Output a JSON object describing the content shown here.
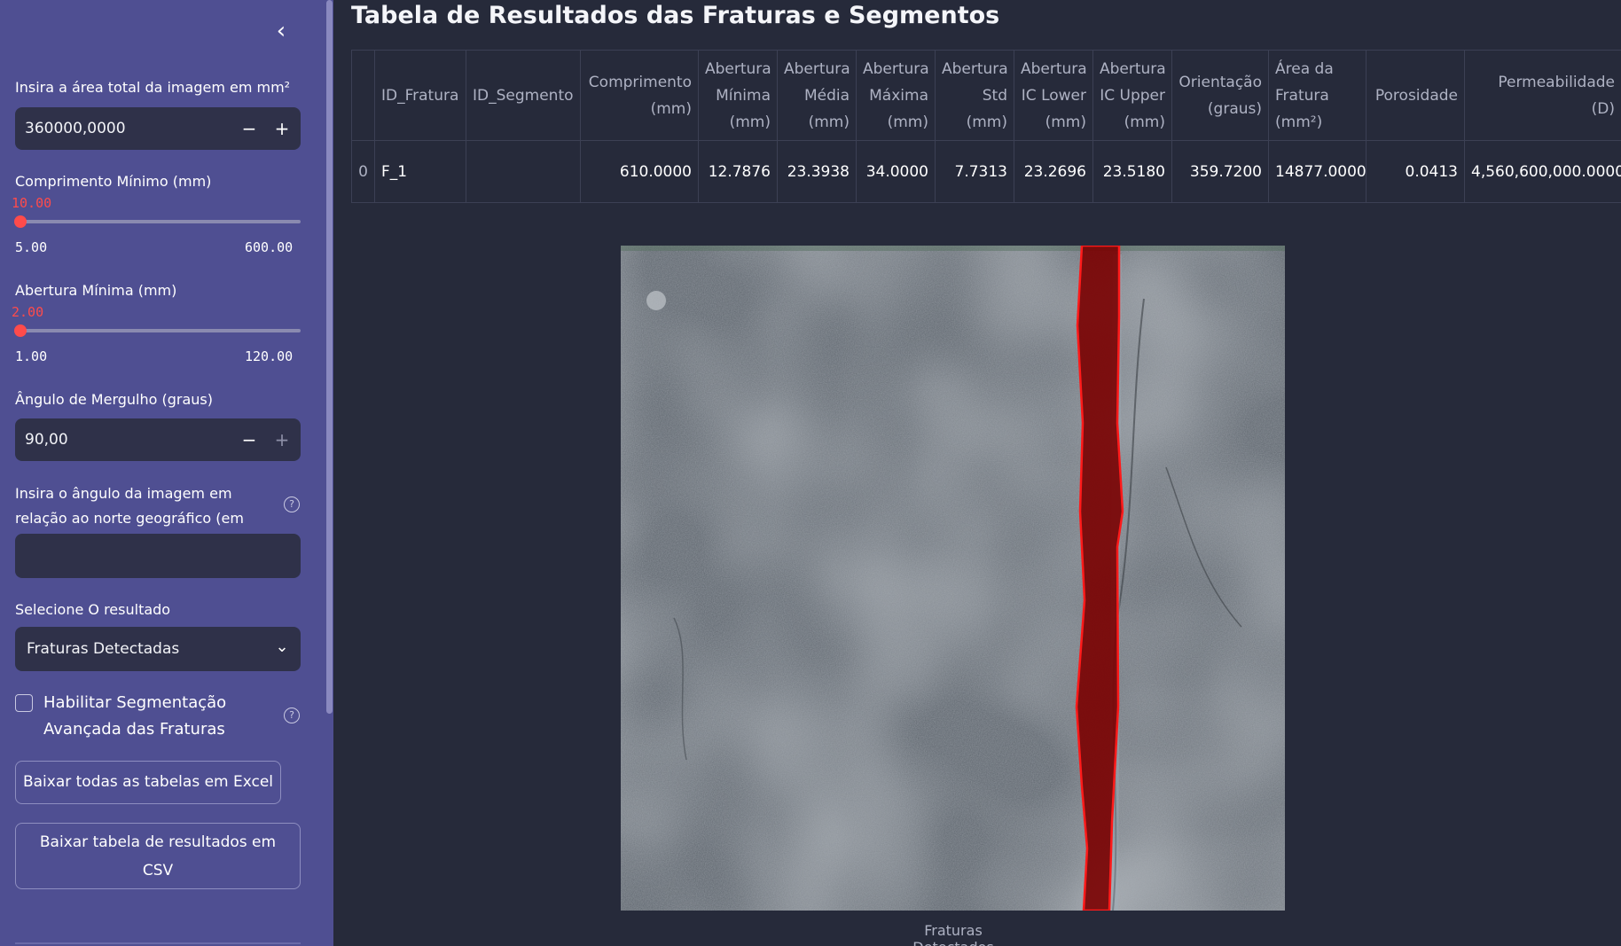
{
  "sidebar": {
    "collapse_icon": "chevron-left-icon",
    "area": {
      "label": "Insira a área total da imagem em mm²",
      "value": "360000,0000",
      "minus": "−",
      "plus": "+"
    },
    "min_length": {
      "label": "Comprimento Mínimo (mm)",
      "value": "10.00",
      "min": "5.00",
      "max": "600.00",
      "fraction": 0.0084
    },
    "min_opening": {
      "label": "Abertura Mínima (mm)",
      "value": "2.00",
      "min": "1.00",
      "max": "120.00",
      "fraction": 0.0084
    },
    "dip_angle": {
      "label": "Ângulo de Mergulho (graus)",
      "value": "90,00",
      "minus": "−",
      "plus": "+"
    },
    "north_angle": {
      "label": "Insira o ângulo da imagem em relação ao norte geográfico (em graus)",
      "value": "",
      "help": "?"
    },
    "result_select": {
      "label": "Selecione O resultado",
      "value": "Fraturas Detectadas"
    },
    "advanced_seg": {
      "label": "Habilitar Segmentação Avançada das Fraturas",
      "checked": false,
      "help": "?"
    },
    "buttons": {
      "excel": "Baixar todas as tabelas em Excel",
      "csv": "Baixar tabela de resultados em CSV"
    }
  },
  "main": {
    "title": "Tabela de Resultados das Fraturas e Segmentos",
    "table": {
      "headers": [
        "",
        "ID_Fratura",
        "ID_Segmento",
        "Comprimento (mm)",
        "Abertura Mínima (mm)",
        "Abertura Média (mm)",
        "Abertura Máxima (mm)",
        "Abertura Std (mm)",
        "Abertura IC Lower (mm)",
        "Abertura IC Upper (mm)",
        "Orientação (graus)",
        "Área da Fratura (mm²)",
        "Porosidade",
        "Permeabilidade (D)"
      ],
      "rows": [
        [
          "0",
          "F_1",
          "",
          "610.0000",
          "12.7876",
          "23.3938",
          "34.0000",
          "7.7313",
          "23.2696",
          "23.5180",
          "359.7200",
          "14877.0000",
          "0.0413",
          "4,560,600,000.0000"
        ]
      ]
    },
    "image_caption": "Fraturas Detectados",
    "colors": {
      "sidebar": "#4f4f92",
      "background": "#262a3a",
      "accent": "#ff4b4b",
      "fracture_mask": "#7a0000"
    }
  }
}
